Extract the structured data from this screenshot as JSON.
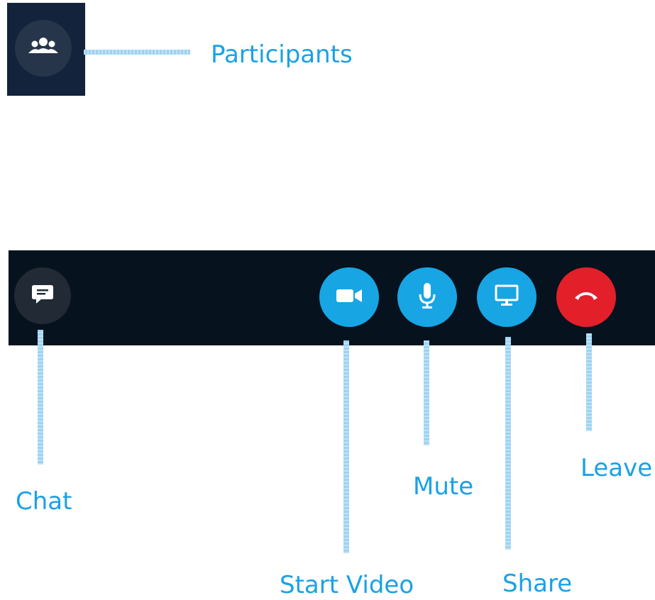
{
  "participants": {
    "label": "Participants",
    "icon": "people-icon"
  },
  "toolbar": {
    "chat": {
      "label": "Chat",
      "icon": "chat-icon"
    },
    "start_video": {
      "label": "Start Video",
      "icon": "video-camera-icon"
    },
    "mute": {
      "label": "Mute",
      "icon": "microphone-icon"
    },
    "share": {
      "label": "Share",
      "icon": "monitor-icon"
    },
    "leave": {
      "label": "Leave",
      "icon": "hang-up-icon"
    }
  },
  "colors": {
    "accent": "#1aa1e6",
    "button_blue": "#17a5e4",
    "button_red": "#e3202a",
    "toolbar_bg": "#06121d",
    "panel_bg": "#12233b"
  }
}
